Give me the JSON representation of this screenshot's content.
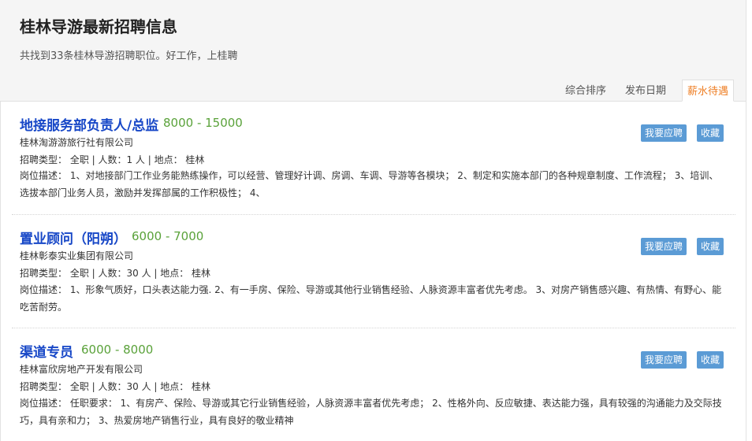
{
  "header": {
    "title": "桂林导游最新招聘信息",
    "subtitle": "共找到33条桂林导游招聘职位。好工作，上桂聘"
  },
  "sort_tabs": [
    {
      "label": "综合排序",
      "active": false
    },
    {
      "label": "发布日期",
      "active": false
    },
    {
      "label": "薪水待遇",
      "active": true
    }
  ],
  "colors": {
    "title_link": "#1747c7",
    "salary": "#5aa23a",
    "button": "#5b9bd5",
    "active_tab": "#ee7d22"
  },
  "jobs": [
    {
      "title": "地接服务部负责人/总监",
      "salary": "8000 - 15000",
      "company": "桂林淘游游旅行社有限公司",
      "meta": "招聘类型： 全职 | 人数：1 人 | 地点： 桂林",
      "description": "岗位描述： 1、对地接部门工作业务能熟练操作，可以经营、管理好计调、房调、车调、导游等各模块； 2、制定和实施本部门的各种规章制度、工作流程； 3、培训、选拔本部门业务人员，激励并发挥部属的工作积极性； 4、",
      "apply_label": "我要应聘",
      "fav_label": "收藏"
    },
    {
      "title": "置业顾问（阳朔）",
      "salary": "6000 - 7000",
      "company": "桂林彰泰实业集团有限公司",
      "meta": "招聘类型： 全职 | 人数：30 人 | 地点： 桂林",
      "description": "岗位描述： 1、形象气质好，口头表达能力强. 2、有一手房、保险、导游或其他行业销售经验、人脉资源丰富者优先考虑。 3、对房产销售感兴趣、有热情、有野心、能吃苦耐劳。",
      "apply_label": "我要应聘",
      "fav_label": "收藏"
    },
    {
      "title": "渠道专员",
      "salary": "6000 - 8000",
      "company": "桂林富欣房地产开发有限公司",
      "meta": "招聘类型： 全职 | 人数：30 人 | 地点： 桂林",
      "description": "岗位描述： 任职要求： 1、有房产、保险、导游或其它行业销售经验，人脉资源丰富者优先考虑； 2、性格外向、反应敏捷、表达能力强，具有较强的沟通能力及交际技巧，具有亲和力； 3、热爱房地产销售行业，具有良好的敬业精神",
      "apply_label": "我要应聘",
      "fav_label": "收藏"
    }
  ]
}
